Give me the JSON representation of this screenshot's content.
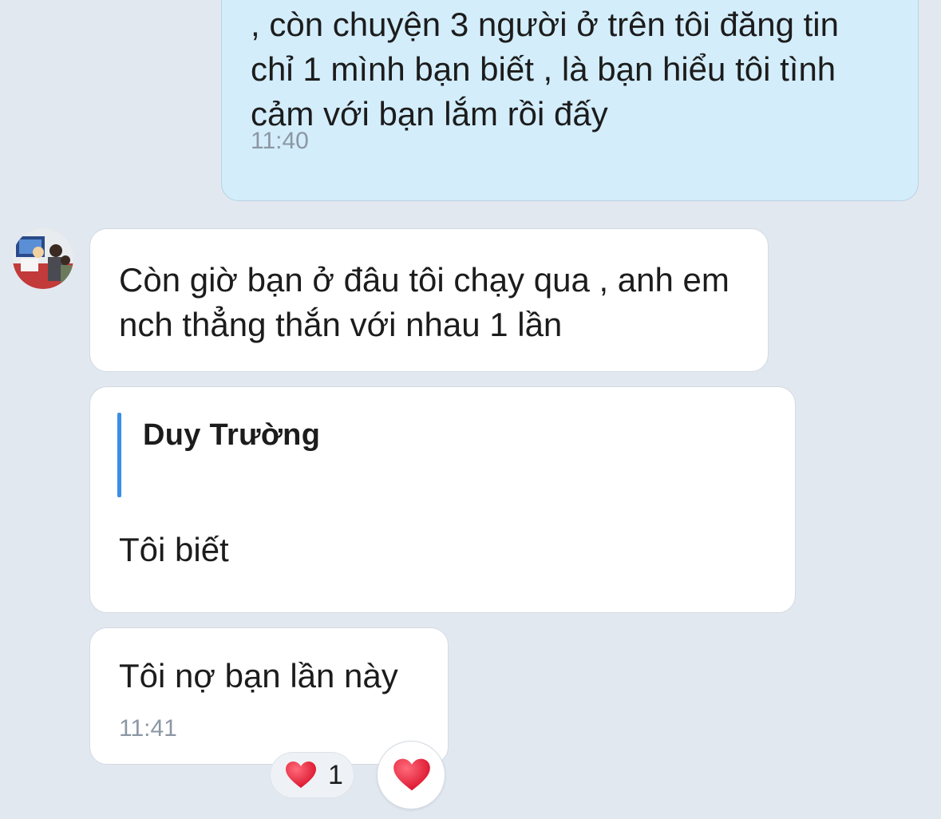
{
  "messages": [
    {
      "direction": "outgoing",
      "text": ", còn chuyện 3 người ở trên tôi đăng tin chỉ 1 mình bạn biết , là bạn hiểu tôi tình cảm với bạn lắm rồi đấy",
      "time": "11:40"
    },
    {
      "direction": "incoming",
      "text": "Còn giờ bạn ở đâu tôi chạy qua , anh em nch thẳng thắn với nhau 1 lần"
    },
    {
      "direction": "incoming",
      "quote_author": "Duy Trường",
      "text": "Tôi biết"
    },
    {
      "direction": "incoming",
      "text": "Tôi nợ bạn lần này",
      "time": "11:41"
    }
  ],
  "reaction": {
    "icon": "heart-icon",
    "count": "1",
    "color": "#e0142b"
  },
  "colors": {
    "background": "#e2e8f0",
    "outgoing_bubble": "#d3edfb",
    "incoming_bubble": "#ffffff",
    "quote_bar": "#3a8ee6",
    "timestamp": "#8c97a3"
  }
}
